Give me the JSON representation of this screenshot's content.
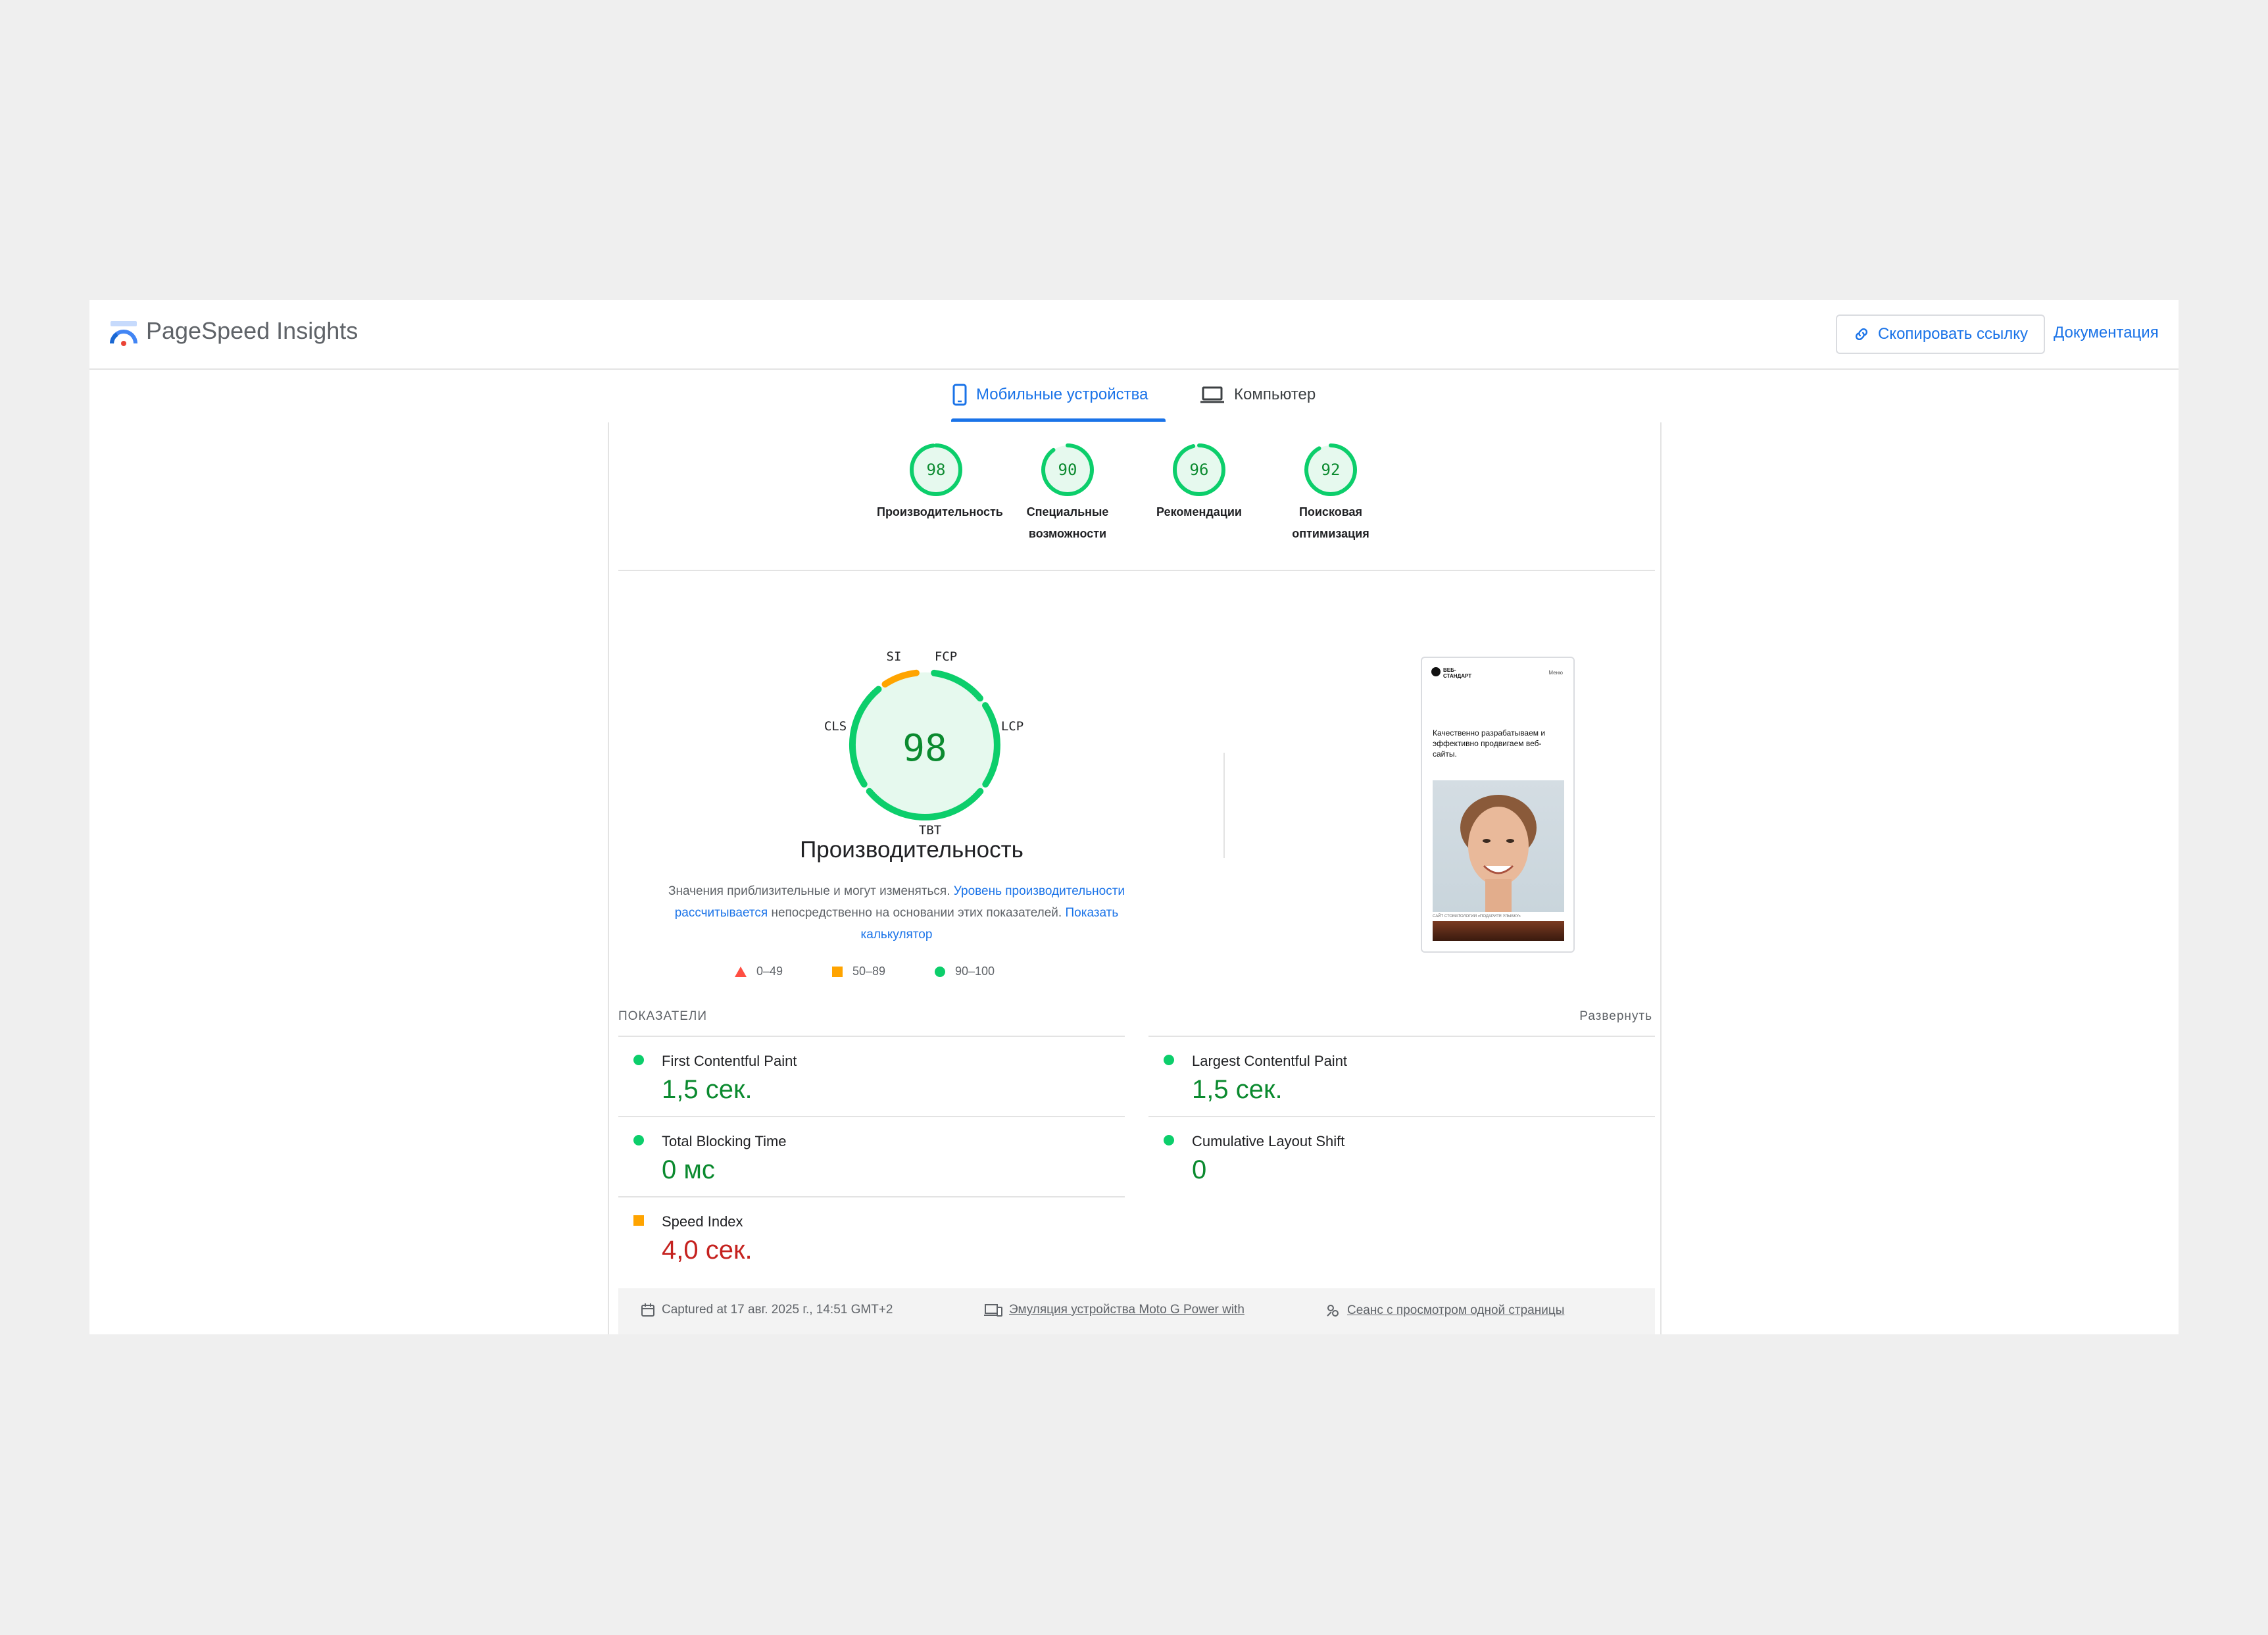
{
  "header": {
    "brand": "PageSpeed Insights",
    "copy_link": "Скопировать ссылку",
    "docs": "Документация"
  },
  "tabs": [
    {
      "label": "Мобильные устройства",
      "icon": "smartphone-icon",
      "active": true
    },
    {
      "label": "Компьютер",
      "icon": "laptop-icon",
      "active": false
    }
  ],
  "colors": {
    "pass": "#0cce6b",
    "average": "#ffa400",
    "fail": "#ff4e42",
    "accent": "#1a73e8"
  },
  "categories": [
    {
      "score": "98",
      "label_line1": "Производительность",
      "label_line2": ""
    },
    {
      "score": "90",
      "label_line1": "Специальные",
      "label_line2": "возможности"
    },
    {
      "score": "96",
      "label_line1": "Рекомендации",
      "label_line2": ""
    },
    {
      "score": "92",
      "label_line1": "Поисковая",
      "label_line2": "оптимизация"
    }
  ],
  "performance": {
    "score": "98",
    "title": "Производительность",
    "gauge_labels": {
      "si": "SI",
      "fcp": "FCP",
      "lcp": "LCP",
      "tbt": "TBT",
      "cls": "CLS"
    },
    "desc_1": "Значения приблизительные и могут изменяться.",
    "desc_link_1": "Уровень производительности рассчитывается",
    "desc_2": "непосредственно на основании этих показателей.",
    "desc_link_2": "Показать калькулятор"
  },
  "legend": [
    {
      "range": "0–49",
      "shape": "triangle"
    },
    {
      "range": "50–89",
      "shape": "square"
    },
    {
      "range": "90–100",
      "shape": "circle"
    }
  ],
  "thumbnail": {
    "logo": "ВЕБ-\nСТАНДАРТ",
    "menu": "Меню",
    "headline": "Качественно разрабатываем и эффективно продвигаем веб-сайты.",
    "caption": "САЙТ СТОМАТОЛОГИИ «ПОДАРИТЕ УЛЫБКУ»"
  },
  "metrics": {
    "heading": "ПОКАЗАТЕЛИ",
    "expand": "Развернуть",
    "items": [
      {
        "name": "First Contentful Paint",
        "value": "1,5 сек.",
        "status": "pass"
      },
      {
        "name": "Largest Contentful Paint",
        "value": "1,5 сек.",
        "status": "pass"
      },
      {
        "name": "Total Blocking Time",
        "value": "0 мс",
        "status": "pass"
      },
      {
        "name": "Cumulative Layout Shift",
        "value": "0",
        "status": "pass"
      },
      {
        "name": "Speed Index",
        "value": "4,0 сек.",
        "status": "average"
      }
    ]
  },
  "footer": {
    "captured": "Captured at 17 авг. 2025 г., 14:51 GMT+2",
    "emulation": "Эмуляция устройства Moto G Power with",
    "session": "Сеанс с просмотром одной страницы"
  }
}
